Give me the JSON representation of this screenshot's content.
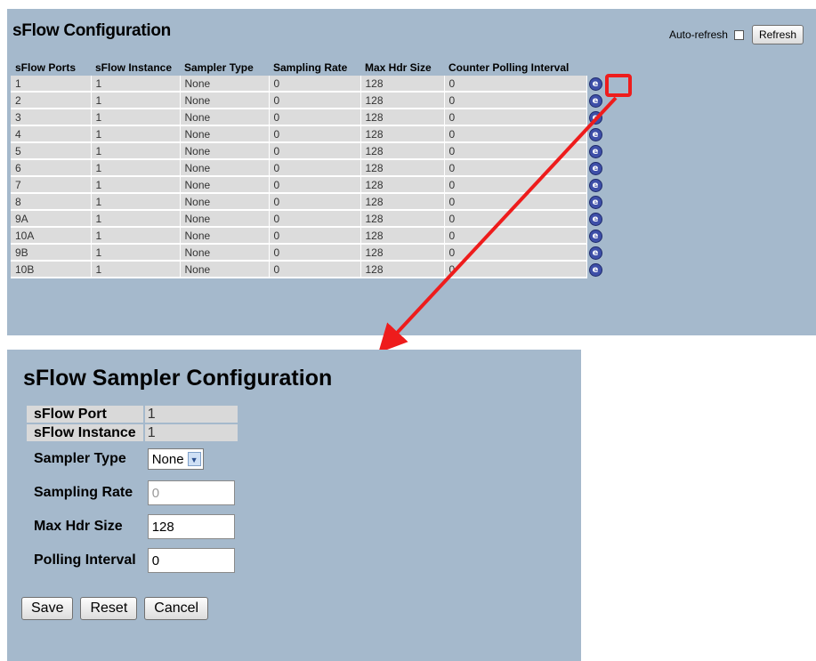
{
  "top": {
    "title": "sFlow Configuration",
    "auto_refresh_label": "Auto-refresh",
    "refresh_label": "Refresh",
    "columns": [
      "sFlow Ports",
      "sFlow Instance",
      "Sampler Type",
      "Sampling Rate",
      "Max Hdr Size",
      "Counter Polling Interval"
    ],
    "rows": [
      {
        "port": "1",
        "instance": "1",
        "sampler": "None",
        "rate": "0",
        "hdr": "128",
        "interval": "0"
      },
      {
        "port": "2",
        "instance": "1",
        "sampler": "None",
        "rate": "0",
        "hdr": "128",
        "interval": "0"
      },
      {
        "port": "3",
        "instance": "1",
        "sampler": "None",
        "rate": "0",
        "hdr": "128",
        "interval": "0"
      },
      {
        "port": "4",
        "instance": "1",
        "sampler": "None",
        "rate": "0",
        "hdr": "128",
        "interval": "0"
      },
      {
        "port": "5",
        "instance": "1",
        "sampler": "None",
        "rate": "0",
        "hdr": "128",
        "interval": "0"
      },
      {
        "port": "6",
        "instance": "1",
        "sampler": "None",
        "rate": "0",
        "hdr": "128",
        "interval": "0"
      },
      {
        "port": "7",
        "instance": "1",
        "sampler": "None",
        "rate": "0",
        "hdr": "128",
        "interval": "0"
      },
      {
        "port": "8",
        "instance": "1",
        "sampler": "None",
        "rate": "0",
        "hdr": "128",
        "interval": "0"
      },
      {
        "port": "9A",
        "instance": "1",
        "sampler": "None",
        "rate": "0",
        "hdr": "128",
        "interval": "0"
      },
      {
        "port": "10A",
        "instance": "1",
        "sampler": "None",
        "rate": "0",
        "hdr": "128",
        "interval": "0"
      },
      {
        "port": "9B",
        "instance": "1",
        "sampler": "None",
        "rate": "0",
        "hdr": "128",
        "interval": "0"
      },
      {
        "port": "10B",
        "instance": "1",
        "sampler": "None",
        "rate": "0",
        "hdr": "128",
        "interval": "0"
      }
    ],
    "edit_icon_glyph": "e"
  },
  "sampler": {
    "title": "sFlow Sampler Configuration",
    "port_label": "sFlow Port",
    "port_value": "1",
    "instance_label": "sFlow Instance",
    "instance_value": "1",
    "type_label": "Sampler Type",
    "type_value": "None",
    "rate_label": "Sampling Rate",
    "rate_value": "0",
    "hdr_label": "Max Hdr Size",
    "hdr_value": "128",
    "interval_label": "Polling Interval",
    "interval_value": "0",
    "save_label": "Save",
    "reset_label": "Reset",
    "cancel_label": "Cancel"
  },
  "icons": {
    "edit": "edit-icon",
    "dropdown": "chevron-down-icon",
    "annotation_arrow": "red-arrow"
  },
  "colors": {
    "panel_bg": "#a5b9cc",
    "row_bg": "#dcdcdc",
    "highlight": "#ee1c1c",
    "edit_icon": "#3e4fa8"
  }
}
